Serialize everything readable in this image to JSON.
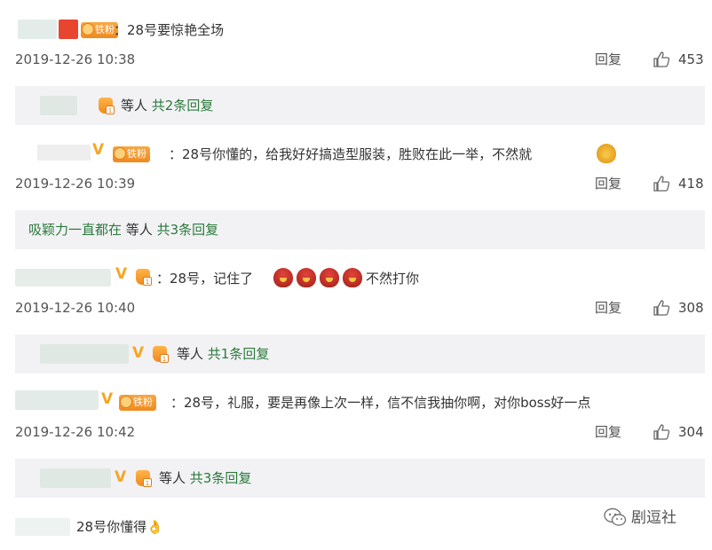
{
  "comments": [
    {
      "text": "：28号要惊艳全场",
      "date": "2019-12-26 10:38",
      "reply_label": "回复",
      "likes": "453",
      "badge": "铁粉"
    },
    {
      "text": "：28号你懂的，给我好好搞造型服装，胜败在此一举，不然就",
      "date": "2019-12-26 10:39",
      "reply_label": "回复",
      "likes": "418",
      "badge": "铁粉"
    },
    {
      "text": "：28号，记住了",
      "text_after": "不然打你",
      "date": "2019-12-26 10:40",
      "reply_label": "回复",
      "likes": "308"
    },
    {
      "text": "：28号，礼服，要是再像上次一样，信不信我抽你啊，对你boss好一点",
      "date": "2019-12-26 10:42",
      "reply_label": "回复",
      "likes": "304",
      "badge": "铁粉"
    },
    {
      "text": "28号你懂得👌"
    }
  ],
  "reply_bars": [
    {
      "prefix": "",
      "mid": "等人",
      "link": "共2条回复"
    },
    {
      "prefix": "吸颖力一直都在",
      "mid": "等人",
      "link": "共3条回复"
    },
    {
      "prefix": "",
      "mid": "等人",
      "link": "共1条回复"
    },
    {
      "prefix": "",
      "mid": "等人",
      "link": "共3条回复"
    }
  ],
  "vip_level": "1",
  "watermark": "剧逗社",
  "colors": {
    "reply_bar_bg": "#f2f2f5",
    "link_green": "#2b7a3b",
    "badge_orange": "#f08a1e"
  },
  "icons": [
    "thumbs-up-icon",
    "vip-shield-icon",
    "verified-v-icon",
    "wechat-icon",
    "angry-bird-emoji"
  ]
}
